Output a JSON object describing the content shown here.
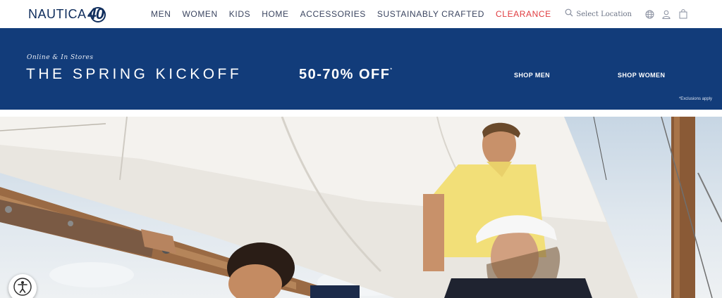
{
  "brand": {
    "name": "NAUTICA",
    "mark": "40",
    "color": "#0f2d5c"
  },
  "nav": {
    "items": [
      {
        "label": "MEN"
      },
      {
        "label": "WOMEN"
      },
      {
        "label": "KIDS"
      },
      {
        "label": "HOME"
      },
      {
        "label": "ACCESSORIES"
      },
      {
        "label": "SUSTAINABLY CRAFTED"
      },
      {
        "label": "CLEARANCE",
        "color": "#e03a3e"
      }
    ]
  },
  "utilities": {
    "search_label": "Select Location",
    "icons": [
      "search-icon",
      "globe-icon",
      "account-icon",
      "shopping-bag-icon"
    ]
  },
  "promo": {
    "background": "#123c7a",
    "kicker": "Online & In Stores",
    "headline": "THE SPRING KICKOFF",
    "offer": "50-70% OFF",
    "offer_mark": "*",
    "shop_men": "SHOP MEN",
    "shop_women": "SHOP WOMEN",
    "fine_print": "*Exclusions apply"
  },
  "hero": {
    "icons": [
      "accessibility-icon"
    ]
  }
}
